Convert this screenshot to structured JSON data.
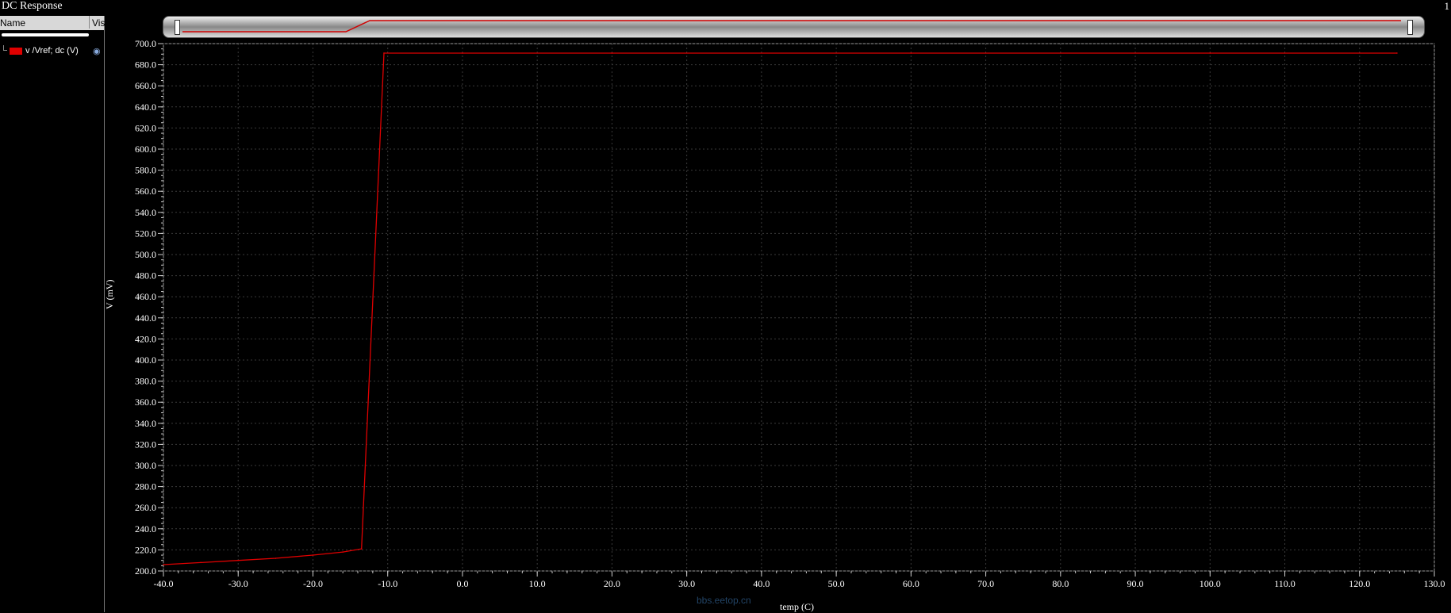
{
  "window": {
    "title": "DC Response",
    "page_number": "1"
  },
  "sidebar": {
    "col_name": "Name",
    "col_vis": "Vis",
    "items": [
      {
        "label": "v /Vref; dc (V)",
        "color": "#e00000",
        "visible_icon": "eye-icon"
      }
    ]
  },
  "watermark": "bbs.eetop.cn",
  "chart_data": {
    "type": "line",
    "xlabel": "temp (C)",
    "ylabel": "V (mV)",
    "xlim": [
      -40,
      130
    ],
    "ylim": [
      200,
      700
    ],
    "x_ticks": [
      "-40.0",
      "-30.0",
      "-20.0",
      "-10.0",
      "0.0",
      "10.0",
      "20.0",
      "30.0",
      "40.0",
      "50.0",
      "60.0",
      "70.0",
      "80.0",
      "90.0",
      "100.0",
      "110.0",
      "120.0",
      "130.0"
    ],
    "y_ticks": [
      "200.0",
      "220.0",
      "240.0",
      "260.0",
      "280.0",
      "300.0",
      "320.0",
      "340.0",
      "360.0",
      "380.0",
      "400.0",
      "420.0",
      "440.0",
      "460.0",
      "480.0",
      "500.0",
      "520.0",
      "540.0",
      "560.0",
      "580.0",
      "600.0",
      "620.0",
      "640.0",
      "660.0",
      "680.0",
      "700.0"
    ],
    "grid": true,
    "background": "#000000",
    "series": [
      {
        "name": "v /Vref; dc (V)",
        "color": "#e00000",
        "x": [
          -40,
          -35,
          -30,
          -25,
          -20,
          -16,
          -13.5,
          -10.5,
          0,
          20,
          60,
          100,
          125
        ],
        "y": [
          206,
          208,
          210,
          212,
          215,
          218,
          221,
          691,
          691,
          691,
          691,
          691,
          691
        ]
      }
    ]
  }
}
